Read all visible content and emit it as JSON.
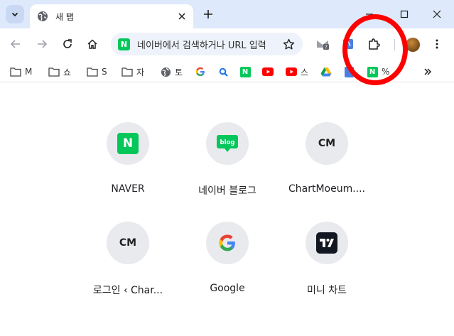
{
  "tab": {
    "title": "새 탭"
  },
  "omnibox": {
    "text": "네이버에서 검색하거나 URL 입력"
  },
  "bookmarks": [
    {
      "label": "M",
      "icon": "folder-icon"
    },
    {
      "label": "쇼",
      "icon": "folder-icon"
    },
    {
      "label": "S",
      "icon": "folder-icon"
    },
    {
      "label": "자",
      "icon": "folder-icon"
    },
    {
      "label": "토",
      "icon": "globe-icon"
    },
    {
      "label": "",
      "icon": "google-icon"
    },
    {
      "label": "",
      "icon": "search-icon"
    },
    {
      "label": "",
      "icon": "naver-icon"
    },
    {
      "label": "",
      "icon": "youtube-icon"
    },
    {
      "label": "스",
      "icon": "youtube-icon"
    },
    {
      "label": "",
      "icon": "google-drive-icon"
    },
    {
      "label": "",
      "icon": "docs-icon"
    },
    {
      "label": "%",
      "icon": "naver-icon"
    }
  ],
  "shortcuts": [
    {
      "label": "NAVER",
      "icon": "naver-icon"
    },
    {
      "label": "네이버 블로그",
      "icon": "blog-icon"
    },
    {
      "label": "ChartMoeum....",
      "icon": "chartmoeum-icon"
    },
    {
      "label": "로그인 ‹ Char...",
      "icon": "chartmoeum-icon"
    },
    {
      "label": "Google",
      "icon": "google-icon"
    },
    {
      "label": "미니 차트",
      "icon": "tradingview-icon"
    }
  ],
  "icon_text": {
    "naver": "N",
    "blog": "blog",
    "cm": "CM",
    "tv": "TV"
  },
  "colors": {
    "titlebar": "#dee9fb",
    "naver": "#03c75a",
    "annotation": "#ff0000"
  }
}
